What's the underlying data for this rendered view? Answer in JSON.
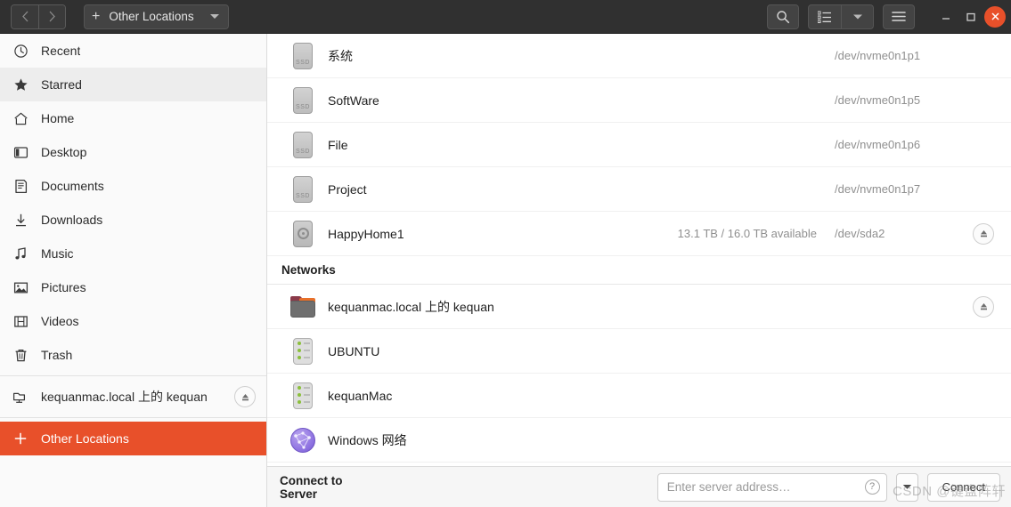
{
  "window": {
    "nav": {
      "back_label": "‹",
      "forward_label": "›"
    },
    "path_button": {
      "plus": "+",
      "label": "Other Locations"
    },
    "buttons": {
      "search": "search-icon",
      "view_list": "list-view-icon",
      "view_dropdown": "chevron-down-icon",
      "menu": "hamburger-menu-icon",
      "minimize": "—",
      "maximize": "□",
      "close": "✕"
    }
  },
  "sidebar": {
    "items": [
      {
        "label": "Recent",
        "icon": "clock-icon",
        "state": "normal"
      },
      {
        "label": "Starred",
        "icon": "star-icon",
        "state": "hovered"
      },
      {
        "label": "Home",
        "icon": "home-icon",
        "state": "normal"
      },
      {
        "label": "Desktop",
        "icon": "desktop-icon",
        "state": "normal"
      },
      {
        "label": "Documents",
        "icon": "document-icon",
        "state": "normal"
      },
      {
        "label": "Downloads",
        "icon": "download-icon",
        "state": "normal"
      },
      {
        "label": "Music",
        "icon": "music-note-icon",
        "state": "normal"
      },
      {
        "label": "Pictures",
        "icon": "picture-icon",
        "state": "normal"
      },
      {
        "label": "Videos",
        "icon": "video-icon",
        "state": "normal"
      },
      {
        "label": "Trash",
        "icon": "trash-icon",
        "state": "normal"
      }
    ],
    "mount": {
      "label": "kequanmac.local 上的 kequan",
      "icon": "network-folder-icon",
      "eject": "⏏"
    },
    "other_locations": {
      "label": "Other Locations",
      "icon": "plus-icon",
      "state": "selected"
    }
  },
  "main": {
    "drives": [
      {
        "name": "系统",
        "icon": "ssd-icon",
        "icon_label": "SSD",
        "meta": "",
        "device": "/dev/nvme0n1p1",
        "eject": false
      },
      {
        "name": "SoftWare",
        "icon": "ssd-icon",
        "icon_label": "SSD",
        "meta": "",
        "device": "/dev/nvme0n1p5",
        "eject": false
      },
      {
        "name": "File",
        "icon": "ssd-icon",
        "icon_label": "SSD",
        "meta": "",
        "device": "/dev/nvme0n1p6",
        "eject": false
      },
      {
        "name": "Project",
        "icon": "ssd-icon",
        "icon_label": "SSD",
        "meta": "",
        "device": "/dev/nvme0n1p7",
        "eject": false
      },
      {
        "name": "HappyHome1",
        "icon": "hdd-icon",
        "icon_label": "",
        "meta": "13.1 TB / 16.0 TB available",
        "device": "/dev/sda2",
        "eject": true
      }
    ],
    "networks_header": "Networks",
    "networks": [
      {
        "name": "kequanmac.local 上的 kequan",
        "icon": "network-folder-icon",
        "eject": true
      },
      {
        "name": "UBUNTU",
        "icon": "server-icon",
        "eject": false
      },
      {
        "name": "kequanMac",
        "icon": "server-icon",
        "eject": false
      },
      {
        "name": "Windows 网络",
        "icon": "network-globe-icon",
        "eject": false
      }
    ]
  },
  "connect_bar": {
    "title": "Connect to Server",
    "address_value": "",
    "address_placeholder": "Enter server address…",
    "help_icon": "?",
    "dropdown_icon": "▾",
    "connect_label": "Connect"
  },
  "watermark": {
    "text": "CSDN @键盘阵轩"
  },
  "colors": {
    "accent": "#e8502a",
    "headerbar": "#303030",
    "sidebar": "#fafafa",
    "main": "#ffffff",
    "muted_text": "#8f8f8f"
  }
}
